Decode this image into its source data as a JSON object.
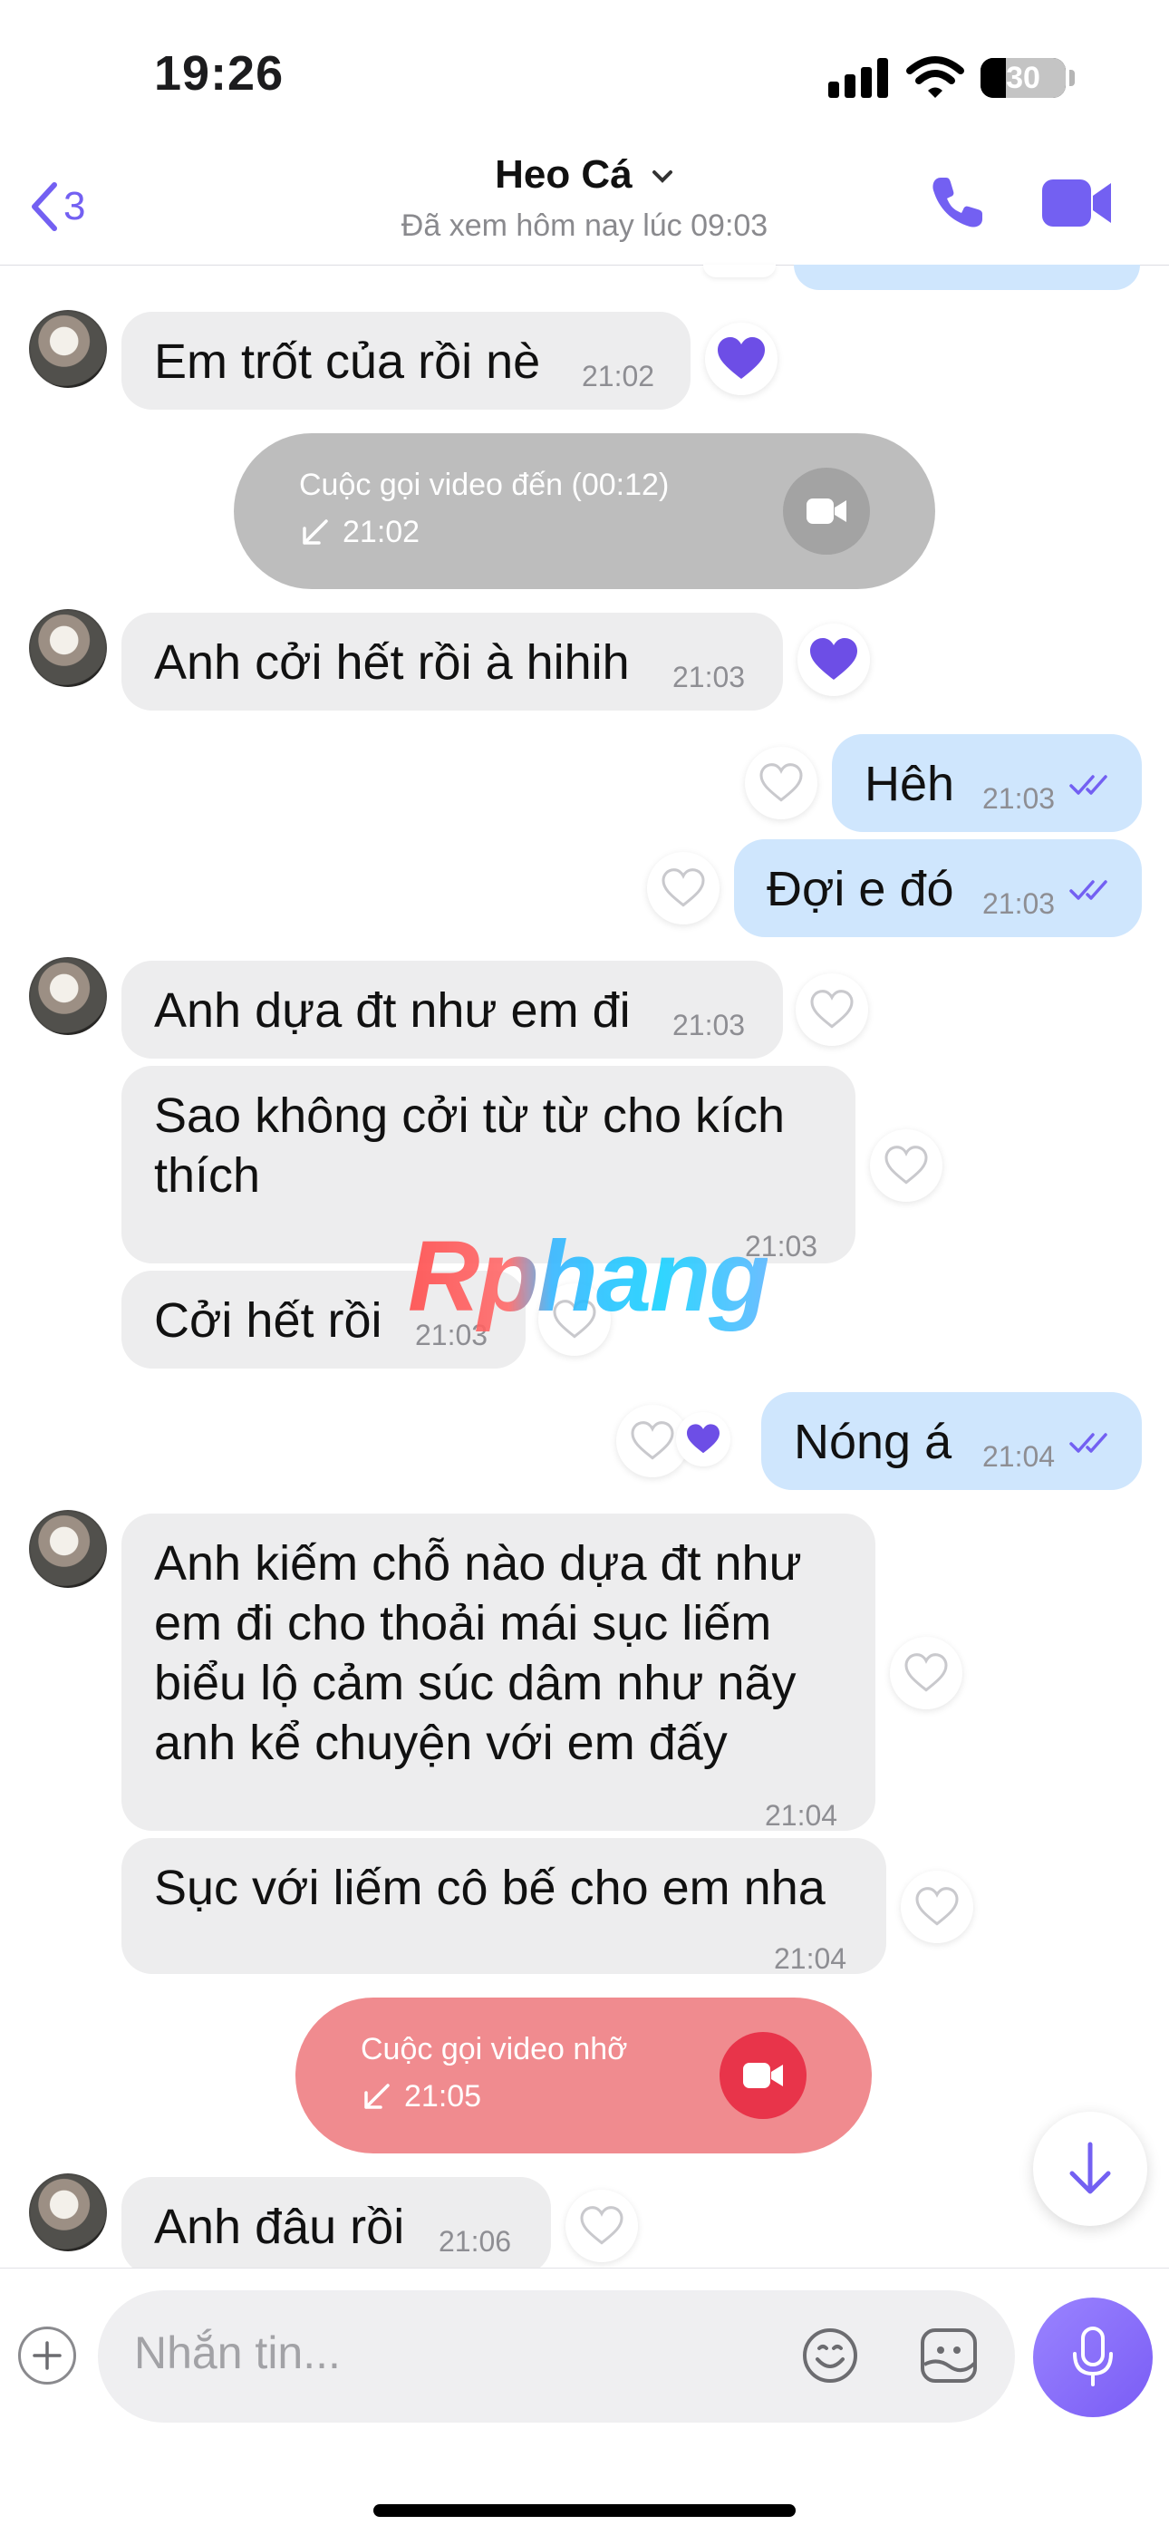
{
  "status_bar": {
    "time": "19:26",
    "battery": "30",
    "battery_level": 0.3
  },
  "header": {
    "back_count": "3",
    "contact_name": "Heo Cá",
    "last_seen": "Đã xem hôm nay lúc 09:03"
  },
  "messages": {
    "m1": {
      "text": "Em trốt của rồi nè",
      "time": "21:02"
    },
    "call1": {
      "title": "Cuộc gọi video đến (00:12)",
      "time": "21:02"
    },
    "m2": {
      "text": "Anh cởi hết rồi à hihih",
      "time": "21:03"
    },
    "m3": {
      "text": "Hêh",
      "time": "21:03"
    },
    "m4": {
      "text": "Đợi e đó",
      "time": "21:03"
    },
    "m5": {
      "text": "Anh dựa đt như em đi",
      "time": "21:03"
    },
    "m6": {
      "line1": "Sao không cởi từ từ cho kích",
      "line2": "thích",
      "time": "21:03"
    },
    "m7": {
      "text": "Cởi hết rồi",
      "time": "21:03"
    },
    "m8": {
      "text": "Nóng á",
      "time": "21:04"
    },
    "m9": {
      "line1": "Anh kiếm chỗ nào dựa đt như",
      "line2": "em đi cho thoải mái sục liếm",
      "line3": "biểu lộ cảm súc dâm như nãy",
      "line4": "anh kể chuyện với em đấy",
      "time": "21:04"
    },
    "m10": {
      "text": "Sục với liếm cô bế cho em nha",
      "time": "21:04"
    },
    "call2": {
      "title": "Cuộc gọi video nhỡ",
      "time": "21:05"
    },
    "m11": {
      "text": "Anh đâu rồi",
      "time": "21:06"
    }
  },
  "watermark": "Rphang",
  "composer": {
    "placeholder": "Nhắn tin..."
  },
  "colors": {
    "accent": "#7360f2",
    "incoming_bubble": "#ededee",
    "outgoing_bubble": "#cfe6fd",
    "incoming_call": "#bdbdbd",
    "missed_call": "#f08b8f",
    "missed_call_icon": "#e8344a"
  },
  "icons": [
    "back-chevron-icon",
    "chevron-down-icon",
    "phone-icon",
    "video-camera-icon",
    "heart-icon",
    "double-check-icon",
    "call-arrow-icon",
    "arrow-down-icon",
    "plus-icon",
    "emoji-icon",
    "sticker-icon",
    "microphone-icon"
  ]
}
